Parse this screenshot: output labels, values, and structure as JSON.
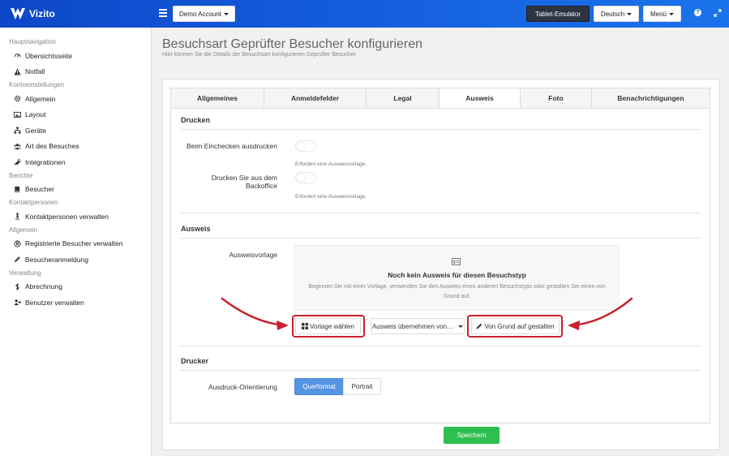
{
  "app": {
    "brand": "Vizito"
  },
  "header": {
    "account_button": "Demo Account",
    "tablet_button": "Tablet-Emulator",
    "language_button": "Deutsch",
    "menu_button": "Menü",
    "help_icon": "?"
  },
  "sidebar": {
    "sections": [
      {
        "title": "Hauptnavigation",
        "items": [
          {
            "label": "Übersichtsseite",
            "icon": "dashboard-icon"
          },
          {
            "label": "Notfall",
            "icon": "warning-icon"
          }
        ]
      },
      {
        "title": "Kontoeinstellungen",
        "items": [
          {
            "label": "Allgemein",
            "icon": "gear-icon"
          },
          {
            "label": "Layout",
            "icon": "image-icon"
          },
          {
            "label": "Geräte",
            "icon": "sitemap-icon"
          },
          {
            "label": "Art des Besuches",
            "icon": "users-icon"
          },
          {
            "label": "Integrationen",
            "icon": "plug-icon"
          }
        ]
      },
      {
        "title": "Berichte",
        "items": [
          {
            "label": "Besucher",
            "icon": "book-icon"
          }
        ]
      },
      {
        "title": "Kontaktpersonen",
        "items": [
          {
            "label": "Kontaktpersonen verwalten",
            "icon": "person-icon"
          }
        ]
      },
      {
        "title": "Allgemein",
        "items": [
          {
            "label": "Registrierte Besucher verwalten",
            "icon": "registered-icon"
          },
          {
            "label": "Besucheranmeldung",
            "icon": "pencil-icon"
          }
        ]
      },
      {
        "title": "Verwaltung",
        "items": [
          {
            "label": "Abrechnung",
            "icon": "dollar-icon"
          },
          {
            "label": "Benutzer verwalten",
            "icon": "user-plus-icon"
          }
        ]
      }
    ]
  },
  "page": {
    "title": "Besuchsart Geprüfter Besucher konfigurieren",
    "subtitle": "Hier können Sie die Details der Besuchsart konfigurieren Geprüfter Besucher"
  },
  "tabs": [
    "Allgemeines",
    "Anmeldefelder",
    "Legal",
    "Ausweis",
    "Foto",
    "Benachrichtigungen"
  ],
  "active_tab": "Ausweis",
  "drucken": {
    "title": "Drucken",
    "checkin_label": "Beim Einchecken ausdrucken",
    "checkin_help": "Erfordert eine Ausweisvorlage.",
    "checkin_enabled": false,
    "backoffice_label": "Drucken Sie aus dem Backoffice",
    "backoffice_help": "Erfordert eine Ausweisvorlage.",
    "backoffice_enabled": false
  },
  "ausweis": {
    "title": "Ausweis",
    "template_label": "Ausweisvorlage",
    "empty_title": "Noch kein Ausweis für diesen Besuchstyp",
    "empty_text": "Beginnen Sie mit einer Vorlage, verwenden Sie den Ausweis eines anderen Besuchstyps oder gestalten Sie einen von Grund auf.",
    "choose_template": "Vorlage wählen",
    "copy_from": "Ausweis übernehmen von…",
    "design_scratch": "Von Grund auf gestalten",
    "highlight_color": "#c8202c"
  },
  "drucker": {
    "title": "Drucker",
    "orientation_label": "Ausdruck-Orientierung",
    "options": [
      "Querformat",
      "Portrait"
    ],
    "selected": "Querformat"
  },
  "footer": {
    "save": "Speichern"
  },
  "colors": {
    "primary": "#1560e0",
    "accent": "#5595e4",
    "success": "#2fbf51"
  }
}
